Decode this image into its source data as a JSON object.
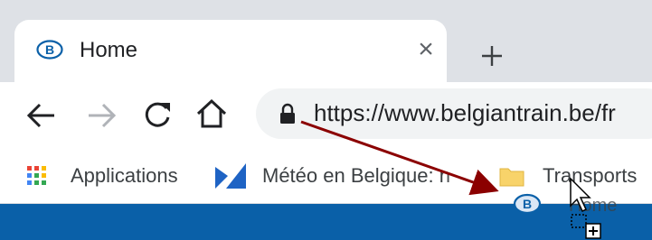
{
  "tab": {
    "title": "Home",
    "favicon": "sncb-logo-icon",
    "close_glyph": "×"
  },
  "new_tab": {
    "icon": "plus-icon"
  },
  "toolbar": {
    "back_icon": "arrow-left-icon",
    "forward_icon": "arrow-right-icon",
    "reload_icon": "reload-icon",
    "home_icon": "home-icon"
  },
  "omnibox": {
    "lock_icon": "lock-icon",
    "url": "https://www.belgiantrain.be/fr"
  },
  "bookmarks": {
    "items": [
      {
        "label": "Applications",
        "icon": "apps-grid-icon"
      },
      {
        "label": "Météo en Belgique: n",
        "icon": "weather-logo-icon"
      },
      {
        "label": "Transports",
        "icon": "folder-icon"
      }
    ]
  },
  "drag": {
    "ghost_label": "Home",
    "cursor_icon": "drag-copy-cursor-icon",
    "arrow_color": "#8b0000"
  },
  "colors": {
    "tabstrip": "#dee1e6",
    "page_header": "#0a60a8",
    "folder": "#f8d36a"
  }
}
